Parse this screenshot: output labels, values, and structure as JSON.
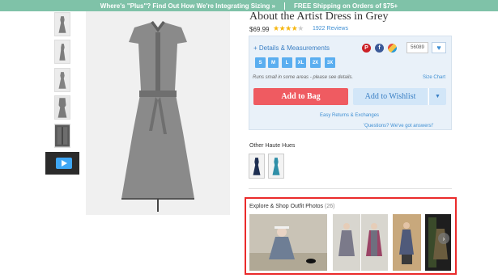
{
  "promo": {
    "left": "Where's \"Plus\"? Find Out How We're Integrating Sizing »",
    "right": "FREE Shipping on Orders of $75+"
  },
  "gallery": {
    "thumbnails": [
      "dress-front",
      "dress-side",
      "dress-back",
      "dress-detail",
      "dress-closeup"
    ],
    "video_thumbnail": "play-video"
  },
  "product": {
    "title": "About the Artist Dress in Grey",
    "price": "$69.99",
    "rating": 4,
    "rating_max": 5,
    "reviews": "1922 Reviews",
    "details_label": "+ Details & Measurements",
    "favorite_count": "56089",
    "sizes": [
      "S",
      "M",
      "L",
      "XL",
      "2X",
      "3X"
    ],
    "fit_note": "Runs small in some areas - please see details.",
    "size_chart": "Size Chart",
    "add_to_bag": "Add to Bag",
    "add_to_wishlist": "Add to Wishlist",
    "returns_link": "Easy Returns & Exchanges",
    "questions_link": "'Questions? We've got answers!'"
  },
  "other_hues": {
    "heading": "Other Haute Hues",
    "swatches": [
      {
        "name": "navy",
        "color": "#1e2f52"
      },
      {
        "name": "teal",
        "color": "#2f8fa8"
      }
    ]
  },
  "outfits": {
    "heading": "Explore & Shop Outfit Photos",
    "count": "(26)"
  },
  "colors": {
    "promo_bg": "#7fc2a8",
    "add_to_bag": "#ef5b61",
    "wishlist": "#d2e6f8",
    "size_pill": "#5aaef0",
    "link": "#3f8fd3",
    "highlight": "#ea2b2b",
    "dress": "#8a8a8a"
  }
}
